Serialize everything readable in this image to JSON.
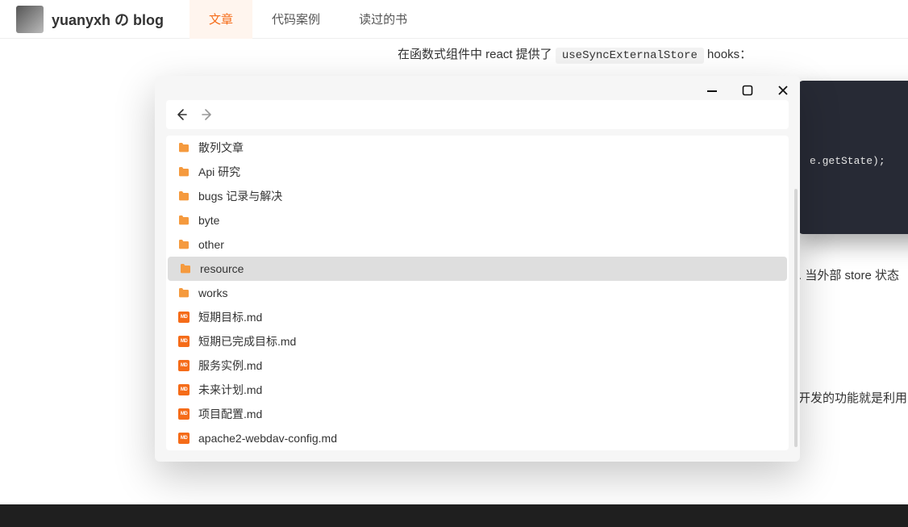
{
  "navbar": {
    "title": "yuanyxh の blog",
    "tabs": [
      {
        "label": "文章",
        "active": true
      },
      {
        "label": "代码案例",
        "active": false
      },
      {
        "label": "读过的书",
        "active": false
      }
    ]
  },
  "content": {
    "paragraph1_pre": "在函数式组件中 react 提供了 ",
    "paragraph1_code": "useSyncExternalStore",
    "paragraph1_post": " hooks：",
    "codeblock_text": "e.getState);",
    "paragraph2_fragment": ". 当外部 store 状态",
    "paragraph3_fragment": "开发的功能就是利用"
  },
  "dialog": {
    "items": [
      {
        "name": "散列文章",
        "type": "folder",
        "selected": false
      },
      {
        "name": "Api 研究",
        "type": "folder",
        "selected": false
      },
      {
        "name": "bugs 记录与解决",
        "type": "folder",
        "selected": false
      },
      {
        "name": "byte",
        "type": "folder",
        "selected": false
      },
      {
        "name": "other",
        "type": "folder",
        "selected": false
      },
      {
        "name": "resource",
        "type": "folder",
        "selected": true
      },
      {
        "name": "works",
        "type": "folder",
        "selected": false
      },
      {
        "name": "短期目标.md",
        "type": "md",
        "selected": false
      },
      {
        "name": "短期已完成目标.md",
        "type": "md",
        "selected": false
      },
      {
        "name": "服务实例.md",
        "type": "md",
        "selected": false
      },
      {
        "name": "未来计划.md",
        "type": "md",
        "selected": false
      },
      {
        "name": "项目配置.md",
        "type": "md",
        "selected": false
      },
      {
        "name": "apache2-webdav-config.md",
        "type": "md",
        "selected": false
      }
    ]
  }
}
